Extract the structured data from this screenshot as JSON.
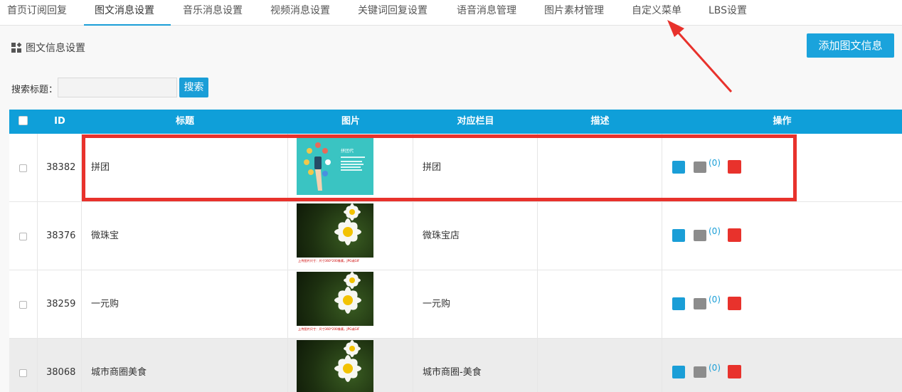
{
  "tabs": [
    {
      "label": "首页订阅回复",
      "active": false
    },
    {
      "label": "图文消息设置",
      "active": true
    },
    {
      "label": "音乐消息设置",
      "active": false
    },
    {
      "label": "视频消息设置",
      "active": false
    },
    {
      "label": "关键词回复设置",
      "active": false
    },
    {
      "label": "语音消息管理",
      "active": false
    },
    {
      "label": "图片素材管理",
      "active": false
    },
    {
      "label": "自定义菜单",
      "active": false
    },
    {
      "label": "LBS设置",
      "active": false
    }
  ],
  "section": {
    "title": "图文信息设置",
    "icon": "grid-icon"
  },
  "toolbar": {
    "add_label": "添加图文信息"
  },
  "search": {
    "label": "搜索标题：",
    "value": "",
    "placeholder": "",
    "button": "搜索"
  },
  "table": {
    "headers": [
      "ID",
      "标题",
      "图片",
      "对应栏目",
      "描述",
      "操作"
    ],
    "rows": [
      {
        "id": "38382",
        "title": "拼团",
        "image": "pt-thumbnail",
        "column": "拼团",
        "desc": "",
        "count": "(0)"
      },
      {
        "id": "38376",
        "title": "微珠宝",
        "image": "daisy-thumbnail",
        "column": "微珠宝店",
        "desc": "",
        "count": "(0)"
      },
      {
        "id": "38259",
        "title": "一元购",
        "image": "daisy-thumbnail",
        "column": "一元购",
        "desc": "",
        "count": "(0)"
      },
      {
        "id": "38068",
        "title": "城市商圈美食",
        "image": "daisy-thumbnail",
        "column": "城市商圈-美食",
        "desc": "",
        "count": "(0)"
      }
    ]
  },
  "thumbnail_texts": {
    "pt_title": "拼团代",
    "daisy_caption": "上传图片尺寸：尺寸360*200像素，JPG或GIF"
  },
  "colors": {
    "accent": "#1a9ed7",
    "highlight": "#e8322c",
    "header": "#0f9fd9"
  }
}
